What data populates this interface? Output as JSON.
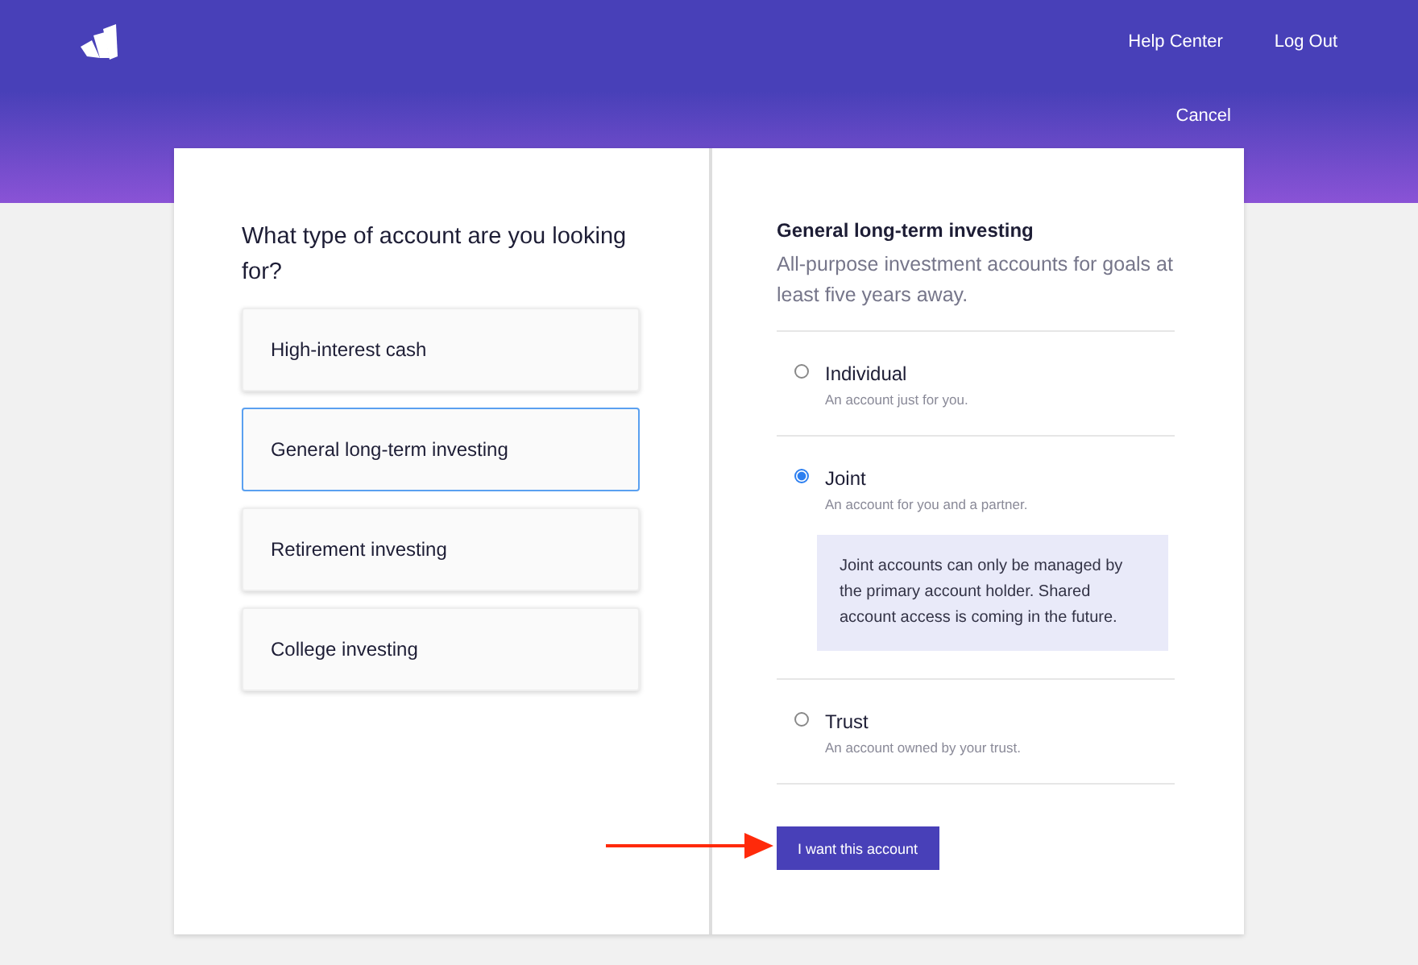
{
  "header": {
    "links": [
      "Help Center",
      "Log Out"
    ],
    "cancel": "Cancel"
  },
  "question": "What type of account are you looking for?",
  "options": [
    {
      "label": "High-interest cash",
      "selected": false
    },
    {
      "label": "General long-term investing",
      "selected": true
    },
    {
      "label": "Retirement investing",
      "selected": false
    },
    {
      "label": "College investing",
      "selected": false
    }
  ],
  "detail": {
    "title": "General long-term investing",
    "description": "All-purpose investment accounts for goals at least five years away.",
    "account_types": [
      {
        "name": "Individual",
        "subtitle": "An account just for you.",
        "selected": false
      },
      {
        "name": "Joint",
        "subtitle": "An account for you and a partner.",
        "selected": true,
        "note": "Joint accounts can only be managed by the primary account holder. Shared account access is coming in the future."
      },
      {
        "name": "Trust",
        "subtitle": "An account owned by your trust.",
        "selected": false
      }
    ],
    "button": "I want this account"
  }
}
